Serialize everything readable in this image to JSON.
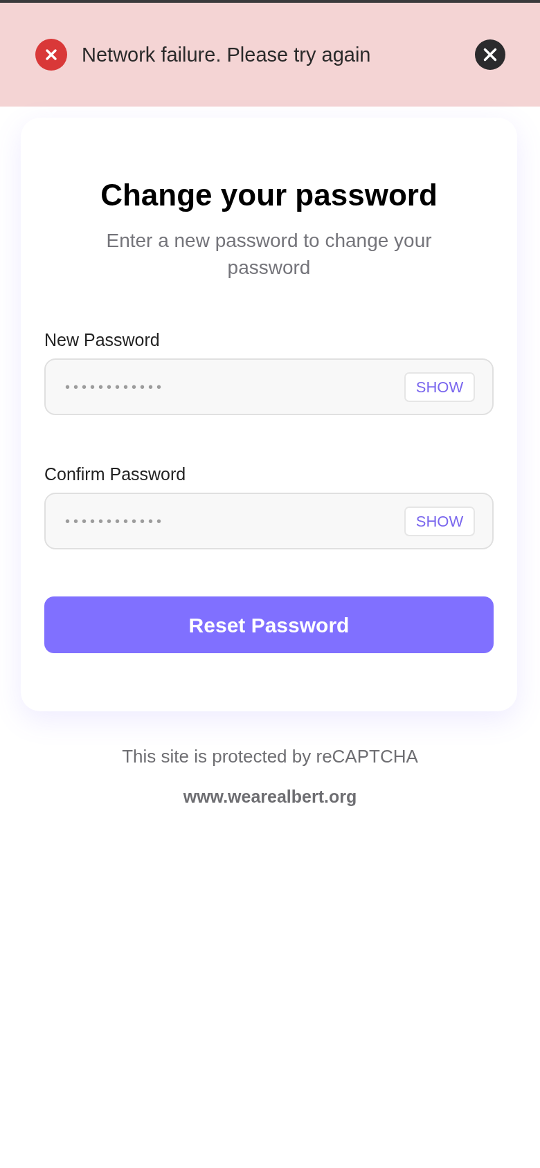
{
  "alert": {
    "kind": "error",
    "message": "Network failure. Please try again"
  },
  "card": {
    "title": "Change your password",
    "subtitle": "Enter a new password to change your password"
  },
  "fields": [
    {
      "label": "New Password",
      "value": "••••••••••••",
      "toggle": "SHOW"
    },
    {
      "label": "Confirm Password",
      "value": "••••••••••••",
      "toggle": "SHOW"
    }
  ],
  "submit": "Reset Password",
  "footer": {
    "notice": "This site is protected by reCAPTCHA",
    "link": "www.wearealbert.org"
  }
}
